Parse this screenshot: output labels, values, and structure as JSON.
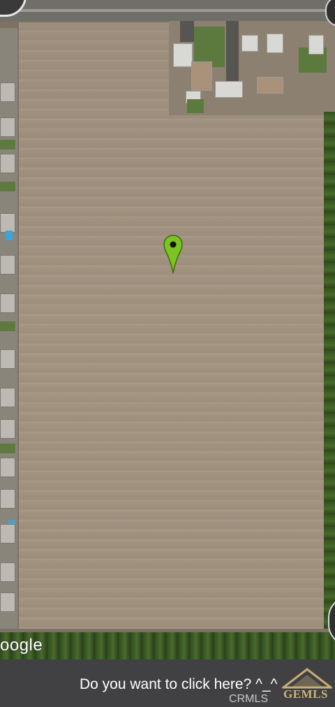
{
  "map": {
    "attribution": "oogle",
    "marker_icon": "map-pin-icon",
    "marker_color": "#7ac51f"
  },
  "prompt": {
    "text": "Do you want to click here? ^_^"
  },
  "watermark": {
    "crmls": "CRMLS",
    "gems": "GEMLS"
  },
  "colors": {
    "bottom_bar": "#414144",
    "field": "#a29380",
    "trees": "#34501e"
  }
}
